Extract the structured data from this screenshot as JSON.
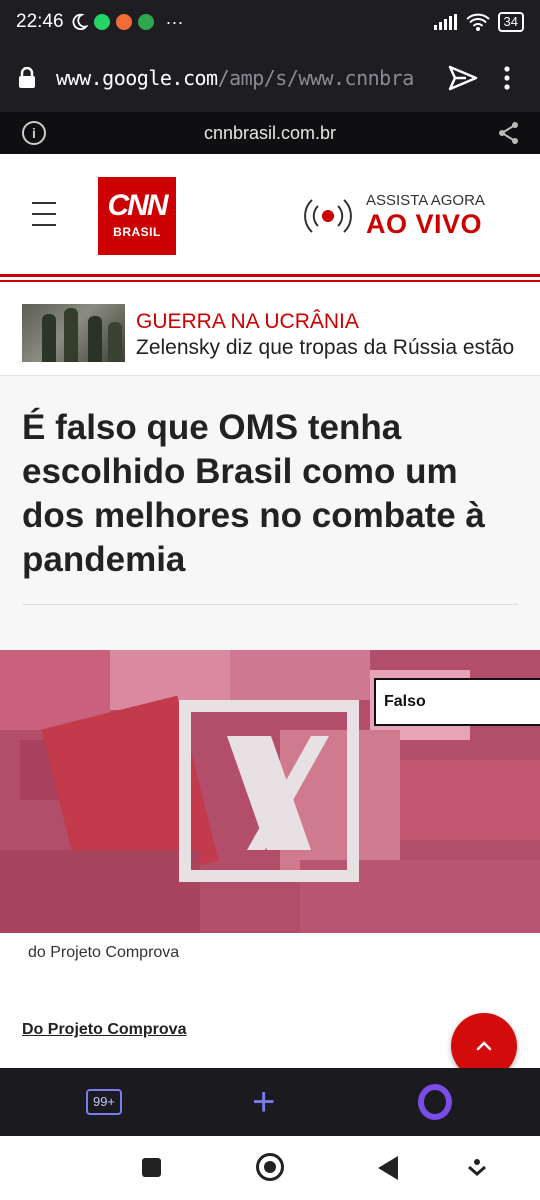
{
  "status_bar": {
    "time": "22:46",
    "battery": "34",
    "more": "···"
  },
  "browser": {
    "url_host": "www.google.com",
    "url_path": "/amp/s/www.cnnbra",
    "site_domain": "cnnbrasil.com.br"
  },
  "header": {
    "logo_main": "CNN",
    "logo_sub": "BRASIL",
    "live_top": "ASSISTA AGORA",
    "live_bottom": "AO VIVO",
    "brand_color": "#cc0000"
  },
  "breaking": {
    "category": "GUERRA NA UCRÂNIA",
    "headline": "Zelensky diz que tropas da Rússia estão"
  },
  "article": {
    "title": "É falso que OMS tenha escolhido Brasil como um dos melhores no combate à pandemia",
    "image_badge": "Falso",
    "image_caption": "do Projeto Comprova",
    "author": "Do Projeto Comprova"
  },
  "bottom_bar": {
    "tabs_count": "99+",
    "new_tab": "+"
  }
}
